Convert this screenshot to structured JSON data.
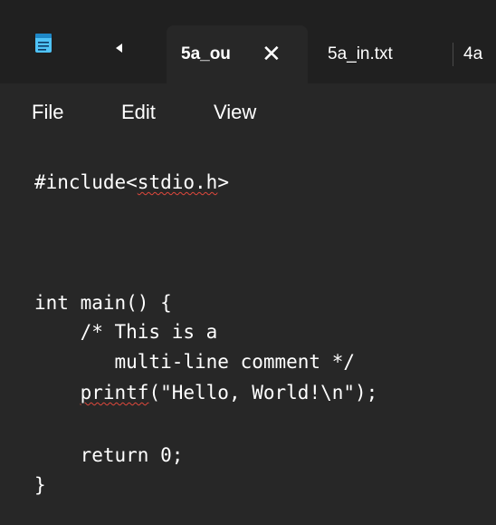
{
  "tabs": {
    "active_label": "5a_ou",
    "close_glyph": "✕",
    "second_label": "5a_in.txt",
    "third_label": "4a"
  },
  "menu": {
    "file": "File",
    "edit": "Edit",
    "view": "View"
  },
  "code": {
    "line1_prefix": "#include<",
    "line1_squiggle": "stdio.h",
    "line1_suffix": ">",
    "line2": "",
    "line3": "",
    "line4": "",
    "line5": "int main() {",
    "line6": "    /* This is a",
    "line7": "       multi-line comment */",
    "line8_indent": "    ",
    "line8_squiggle": "printf",
    "line8_rest": "(\"Hello, World!\\n\");",
    "line9": "",
    "line10": "    return 0;",
    "line11": "}"
  },
  "colors": {
    "background": "#272727",
    "tabbar": "#202020",
    "text": "#ffffff",
    "spellcheck": "#e0483c",
    "notepad_icon": "#4fc3f7"
  },
  "icons": {
    "app": "notepad-icon",
    "nav": "back-arrow-icon",
    "close": "close-icon"
  }
}
